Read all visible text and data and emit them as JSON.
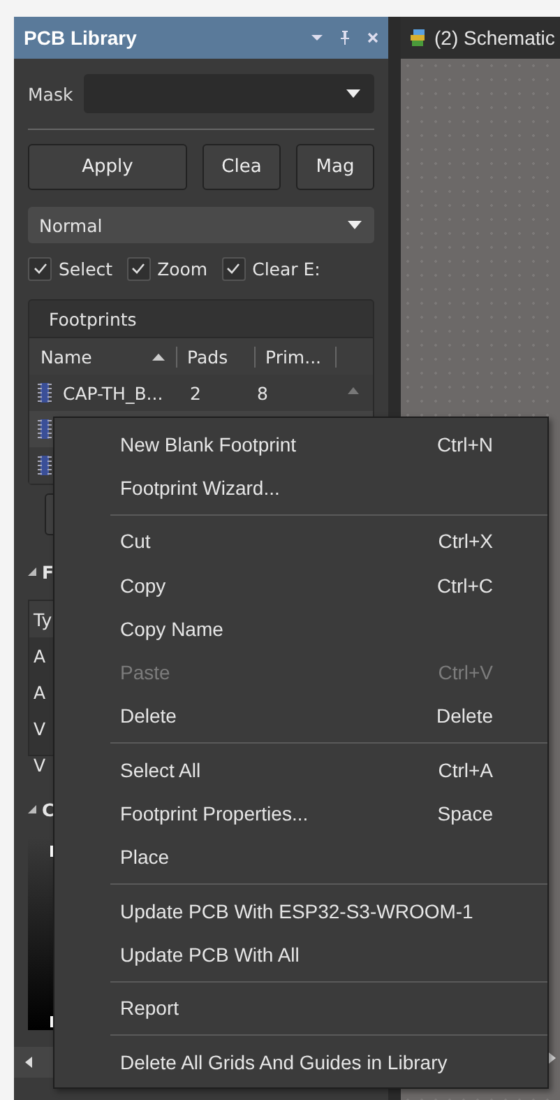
{
  "panel": {
    "title": "PCB Library",
    "mask_label": "Mask",
    "buttons": [
      "Apply",
      "Clea",
      "Mag"
    ],
    "mode": "Normal",
    "options": [
      {
        "label": "Select",
        "checked": true
      },
      {
        "label": "Zoom",
        "checked": true
      },
      {
        "label": "Clear E:",
        "checked": true
      }
    ],
    "footprints": {
      "title": "Footprints",
      "columns": [
        "Name",
        "Pads",
        "Prim..."
      ],
      "rows": [
        {
          "kind": "row",
          "name": "CAP-TH_B...",
          "pads": "2",
          "primitives": "8"
        },
        {
          "kind": "covered"
        },
        {
          "kind": "covered"
        }
      ]
    },
    "section_2": {
      "title": "F",
      "header": "Ty",
      "rows": [
        "A",
        "A",
        "V",
        "V"
      ]
    },
    "section_3": {
      "title": "C"
    }
  },
  "document_tab": {
    "title": "(2) Schematic"
  },
  "context_menu": [
    {
      "kind": "item",
      "label": "New Blank Footprint",
      "shortcut": "Ctrl+N",
      "disabled": false
    },
    {
      "kind": "item",
      "label": "Footprint Wizard...",
      "disabled": false
    },
    {
      "kind": "separator"
    },
    {
      "kind": "item",
      "label": "Cut",
      "shortcut": "Ctrl+X",
      "disabled": false
    },
    {
      "kind": "item",
      "label": "Copy",
      "shortcut": "Ctrl+C",
      "disabled": false
    },
    {
      "kind": "item",
      "label": "Copy Name",
      "disabled": false
    },
    {
      "kind": "item",
      "label": "Paste",
      "shortcut": "Ctrl+V",
      "disabled": true
    },
    {
      "kind": "item",
      "label": "Delete",
      "shortcut": "Delete",
      "disabled": false
    },
    {
      "kind": "separator"
    },
    {
      "kind": "item",
      "label": "Select All",
      "shortcut": "Ctrl+A",
      "disabled": false
    },
    {
      "kind": "item",
      "label": "Footprint Properties...",
      "shortcut": "Space",
      "disabled": false
    },
    {
      "kind": "item",
      "label": "Place",
      "disabled": false
    },
    {
      "kind": "separator"
    },
    {
      "kind": "item",
      "label": "Update PCB With ESP32-S3-WROOM-1",
      "disabled": false
    },
    {
      "kind": "item",
      "label": "Update PCB With All",
      "disabled": false
    },
    {
      "kind": "separator"
    },
    {
      "kind": "item",
      "label": "Report",
      "disabled": false
    },
    {
      "kind": "separator"
    },
    {
      "kind": "item",
      "label": "Delete All Grids And Guides in Library",
      "disabled": false
    }
  ]
}
